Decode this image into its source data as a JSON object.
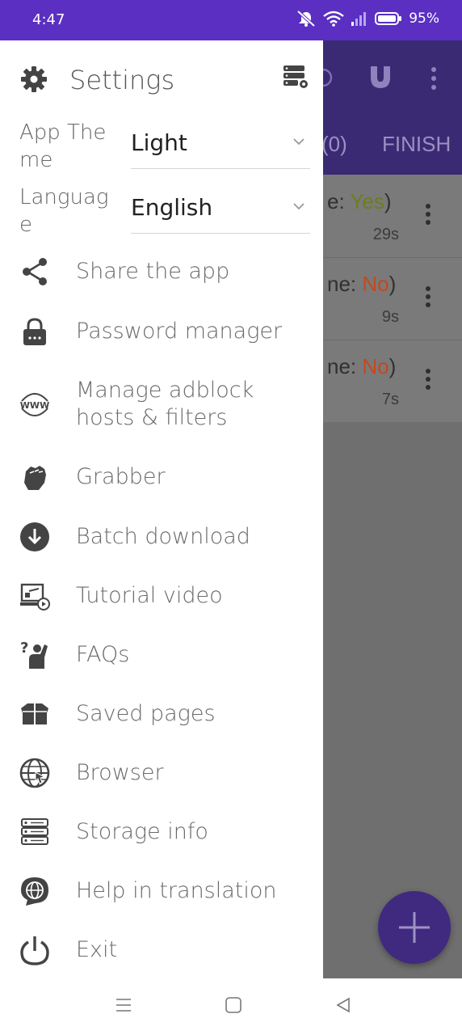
{
  "status_bar": {
    "time": "4:47",
    "battery": "95%"
  },
  "background_app": {
    "tab_partial_1": "(0)",
    "tab_partial_2": "FINISH",
    "rows": [
      {
        "status_prefix": "e: ",
        "status_value": "Yes",
        "status_suffix": ")",
        "duration": "29s"
      },
      {
        "status_prefix": "ne: ",
        "status_value": "No",
        "status_suffix": ")",
        "duration": "9s"
      },
      {
        "status_prefix": "ne: ",
        "status_value": "No",
        "status_suffix": ")",
        "duration": "7s"
      }
    ]
  },
  "drawer": {
    "title": "Settings",
    "prefs": {
      "theme": {
        "label": "App Theme",
        "value": "Light"
      },
      "language": {
        "label": "Language",
        "value": "English"
      }
    },
    "items": [
      {
        "label": "Share the app",
        "icon": "share-icon"
      },
      {
        "label": "Password manager",
        "icon": "lock-icon"
      },
      {
        "label": "Manage adblock hosts & filters",
        "icon": "www-icon"
      },
      {
        "label": "Grabber",
        "icon": "fist-icon"
      },
      {
        "label": "Batch download",
        "icon": "download-circle-icon"
      },
      {
        "label": "Tutorial video",
        "icon": "video-tutorial-icon"
      },
      {
        "label": "FAQs",
        "icon": "faq-icon"
      },
      {
        "label": "Saved pages",
        "icon": "box-icon"
      },
      {
        "label": "Browser",
        "icon": "globe-icon"
      },
      {
        "label": "Storage info",
        "icon": "storage-icon"
      },
      {
        "label": "Help in translation",
        "icon": "translate-icon"
      },
      {
        "label": "Exit",
        "icon": "power-icon"
      }
    ]
  },
  "colors": {
    "status_bar": "#5a2fc2",
    "accent": "#3f2a80",
    "yes": "#6b7d20",
    "no": "#c4481f"
  }
}
